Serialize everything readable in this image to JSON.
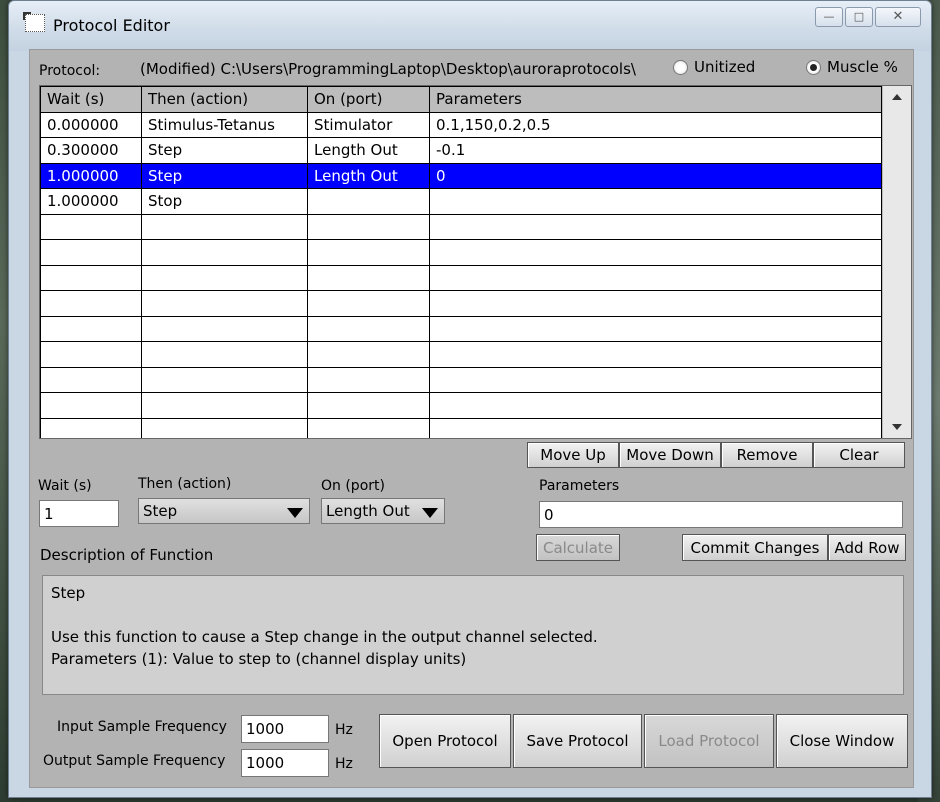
{
  "window": {
    "title": "Protocol Editor"
  },
  "protocol": {
    "label": "Protocol:",
    "path": "(Modified) C:\\Users\\ProgrammingLaptop\\Desktop\\auroraprotocols\\",
    "units": [
      {
        "label": "Unitized",
        "selected": false
      },
      {
        "label": "Muscle %",
        "selected": true
      }
    ]
  },
  "table": {
    "headers": [
      "Wait (s)",
      "Then (action)",
      "On (port)",
      "Parameters"
    ],
    "rows": [
      [
        "0.000000",
        "Stimulus-Tetanus",
        "Stimulator",
        "0.1,150,0.2,0.5"
      ],
      [
        "0.300000",
        "Step",
        "Length Out",
        "-0.1"
      ],
      [
        "1.000000",
        "Step",
        "Length Out",
        "0"
      ],
      [
        "1.000000",
        "Stop",
        "",
        ""
      ]
    ],
    "selected_row": 2,
    "empty_rows": 9
  },
  "list_buttons": {
    "move_up": "Move Up",
    "move_down": "Move Down",
    "remove": "Remove",
    "clear": "Clear"
  },
  "editor": {
    "wait_label": "Wait (s)",
    "wait_value": "1",
    "action_label": "Then (action)",
    "action_value": "Step",
    "port_label": "On (port)",
    "port_value": "Length Out",
    "params_label": "Parameters",
    "params_value": "0",
    "calculate": "Calculate",
    "commit": "Commit Changes",
    "add_row": "Add Row"
  },
  "description": {
    "label": "Description of Function",
    "title": "Step",
    "line1": "Use this function to cause a Step change in the output channel selected.",
    "line2": "Parameters (1): Value to step to (channel display units)"
  },
  "sampling": {
    "input_label": "Input Sample Frequency",
    "input_value": "1000",
    "output_label": "Output Sample Frequency",
    "output_value": "1000",
    "unit": "Hz"
  },
  "footer_buttons": {
    "open": "Open Protocol",
    "save": "Save Protocol",
    "load": "Load Protocol",
    "close": "Close Window"
  },
  "colors": {
    "selection": "#0000ff",
    "panel": "#b3b3b3"
  }
}
